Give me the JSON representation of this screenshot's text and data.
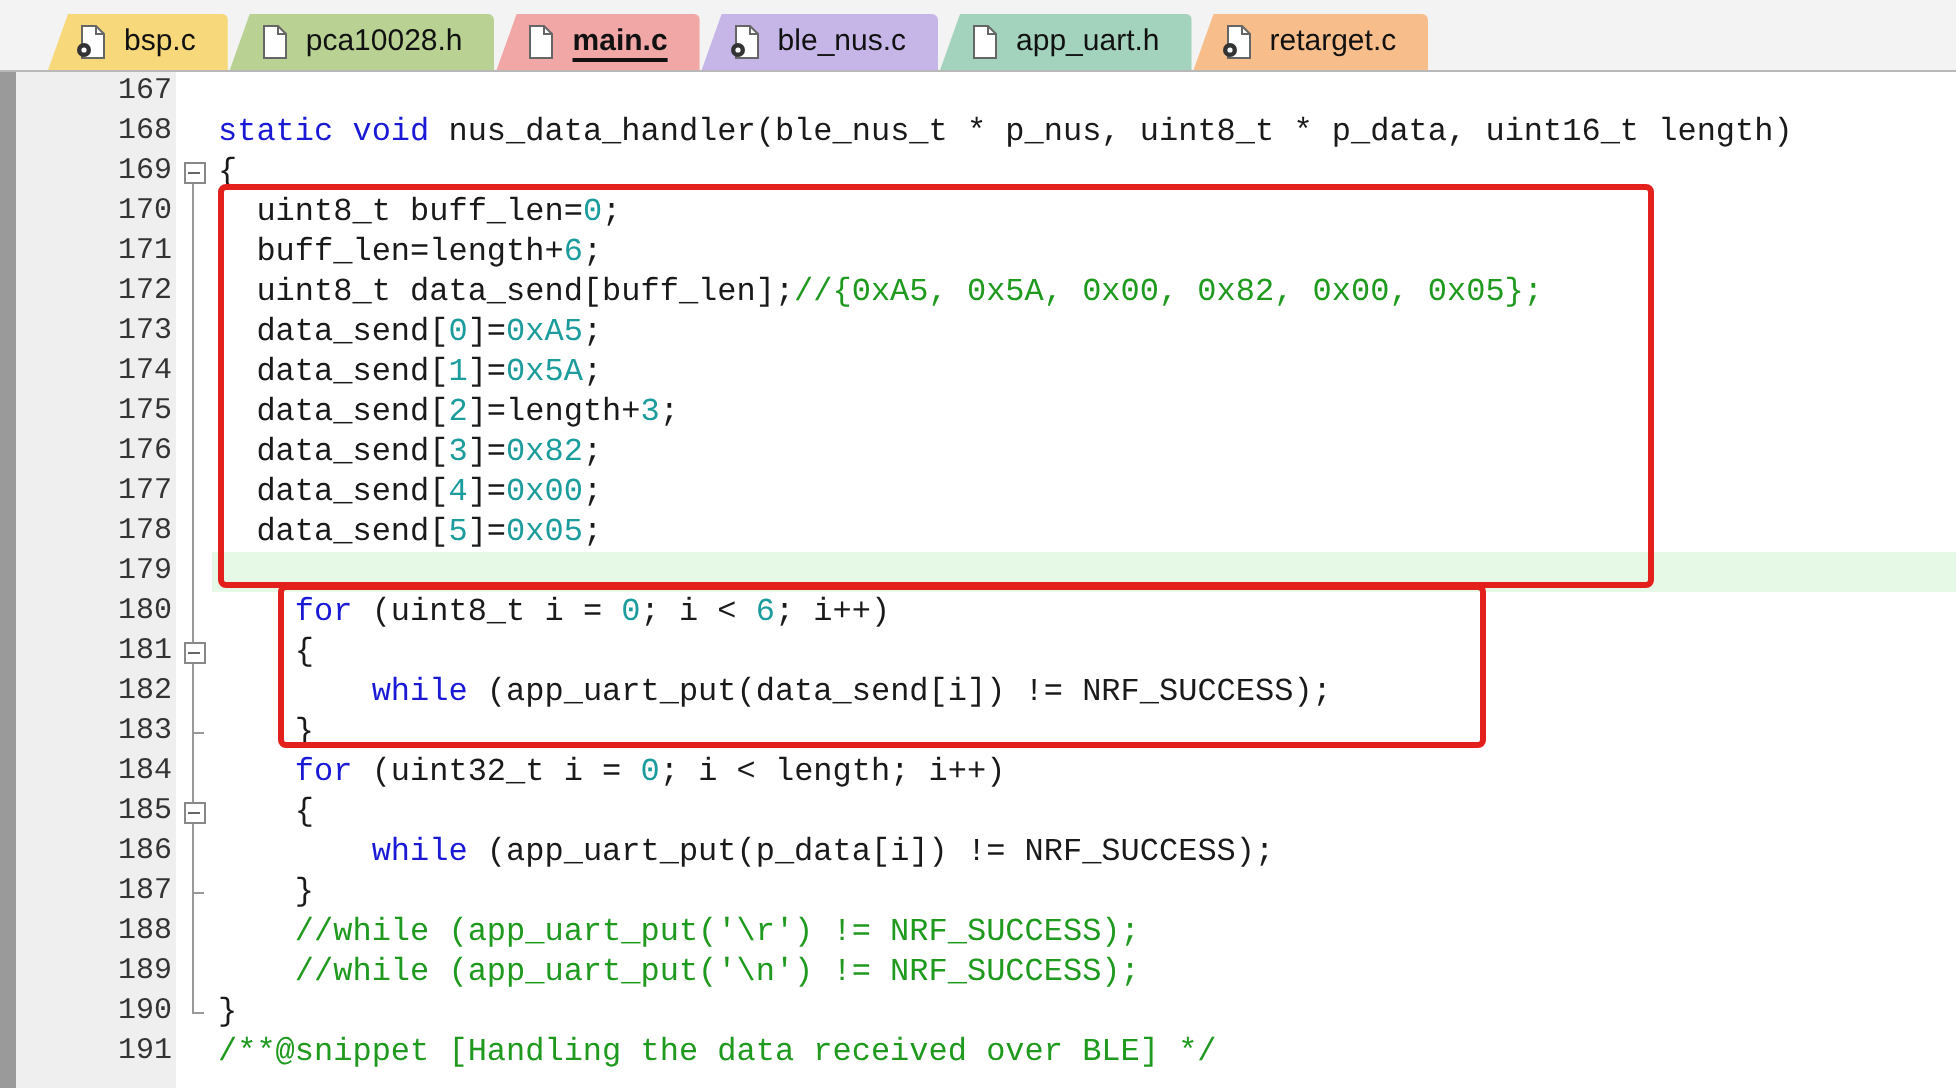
{
  "tabs": [
    {
      "label": "bsp.c",
      "kind": "source",
      "color": "#f7d87a",
      "selected": false
    },
    {
      "label": "pca10028.h",
      "kind": "header",
      "color": "#b9d193",
      "selected": false
    },
    {
      "label": "main.c",
      "kind": "header",
      "color": "#f2a7a7",
      "selected": true
    },
    {
      "label": "ble_nus.c",
      "kind": "source",
      "color": "#c6b6e8",
      "selected": false
    },
    {
      "label": "app_uart.h",
      "kind": "header",
      "color": "#a3d3bc",
      "selected": false
    },
    {
      "label": "retarget.c",
      "kind": "source",
      "color": "#f7be8c",
      "selected": false
    }
  ],
  "lines": [
    {
      "number": "167",
      "fold_start": false,
      "fold_end": false,
      "current": false,
      "box_start": false,
      "box_end": false
    },
    {
      "number": "168",
      "fold_start": false,
      "fold_end": false,
      "current": false,
      "box_start": false,
      "box_end": false,
      "tokens": [
        {
          "kind": "keyword",
          "text": "static"
        },
        {
          "kind": "keyword",
          "text": " void"
        },
        {
          "kind": "plain",
          "text": " nus_data_handler(ble_nus_t * p_nus, uint8_t * p_data, uint16_t length)"
        }
      ]
    },
    {
      "number": "169",
      "fold_start": true,
      "fold_end": false,
      "current": false,
      "box_start": false,
      "box_end": false,
      "tokens": [
        {
          "kind": "plain",
          "text": "{"
        }
      ]
    },
    {
      "number": "170",
      "fold_start": false,
      "fold_end": false,
      "current": false,
      "box_start": true,
      "box_end": false,
      "tokens": [
        {
          "kind": "plain",
          "text": "  uint8_t buff_len="
        },
        {
          "kind": "number",
          "text": "0"
        },
        {
          "kind": "plain",
          "text": ";"
        }
      ]
    },
    {
      "number": "171",
      "fold_start": false,
      "fold_end": false,
      "current": false,
      "box_start": false,
      "box_end": false,
      "tokens": [
        {
          "kind": "plain",
          "text": "  buff_len=length+"
        },
        {
          "kind": "number",
          "text": "6"
        },
        {
          "kind": "plain",
          "text": ";"
        }
      ]
    },
    {
      "number": "172",
      "fold_start": false,
      "fold_end": false,
      "current": false,
      "box_start": false,
      "box_end": false,
      "tokens": [
        {
          "kind": "plain",
          "text": "  uint8_t data_send[buff_len];"
        },
        {
          "kind": "comment",
          "text": "//{0xA5, 0x5A, 0x00, 0x82, 0x00, 0x05};"
        }
      ]
    },
    {
      "number": "173",
      "fold_start": false,
      "fold_end": false,
      "current": false,
      "box_start": false,
      "box_end": false,
      "tokens": [
        {
          "kind": "plain",
          "text": "  data_send["
        },
        {
          "kind": "number",
          "text": "0"
        },
        {
          "kind": "plain",
          "text": "]="
        },
        {
          "kind": "number",
          "text": "0xA5"
        },
        {
          "kind": "plain",
          "text": ";"
        }
      ]
    },
    {
      "number": "174",
      "fold_start": false,
      "fold_end": false,
      "current": false,
      "box_start": false,
      "box_end": false,
      "tokens": [
        {
          "kind": "plain",
          "text": "  data_send["
        },
        {
          "kind": "number",
          "text": "1"
        },
        {
          "kind": "plain",
          "text": "]="
        },
        {
          "kind": "number",
          "text": "0x5A"
        },
        {
          "kind": "plain",
          "text": ";"
        }
      ]
    },
    {
      "number": "175",
      "fold_start": false,
      "fold_end": false,
      "current": false,
      "box_start": false,
      "box_end": false,
      "tokens": [
        {
          "kind": "plain",
          "text": "  data_send["
        },
        {
          "kind": "number",
          "text": "2"
        },
        {
          "kind": "plain",
          "text": "]=length+"
        },
        {
          "kind": "number",
          "text": "3"
        },
        {
          "kind": "plain",
          "text": ";"
        }
      ]
    },
    {
      "number": "176",
      "fold_start": false,
      "fold_end": false,
      "current": false,
      "box_start": false,
      "box_end": false,
      "tokens": [
        {
          "kind": "plain",
          "text": "  data_send["
        },
        {
          "kind": "number",
          "text": "3"
        },
        {
          "kind": "plain",
          "text": "]="
        },
        {
          "kind": "number",
          "text": "0x82"
        },
        {
          "kind": "plain",
          "text": ";"
        }
      ]
    },
    {
      "number": "177",
      "fold_start": false,
      "fold_end": false,
      "current": false,
      "box_start": false,
      "box_end": false,
      "tokens": [
        {
          "kind": "plain",
          "text": "  data_send["
        },
        {
          "kind": "number",
          "text": "4"
        },
        {
          "kind": "plain",
          "text": "]="
        },
        {
          "kind": "number",
          "text": "0x00"
        },
        {
          "kind": "plain",
          "text": ";"
        }
      ]
    },
    {
      "number": "178",
      "fold_start": false,
      "fold_end": false,
      "current": false,
      "box_start": false,
      "box_end": false,
      "tokens": [
        {
          "kind": "plain",
          "text": "  data_send["
        },
        {
          "kind": "number",
          "text": "5"
        },
        {
          "kind": "plain",
          "text": "]="
        },
        {
          "kind": "number",
          "text": "0x05"
        },
        {
          "kind": "plain",
          "text": ";"
        }
      ]
    },
    {
      "number": "179",
      "fold_start": false,
      "fold_end": false,
      "current": true,
      "box_start": false,
      "box_end": true
    },
    {
      "number": "180",
      "fold_start": false,
      "fold_end": false,
      "current": false,
      "box_start": true,
      "box_end": false,
      "tokens": [
        {
          "kind": "keyword",
          "text": "    for"
        },
        {
          "kind": "plain",
          "text": " (uint8_t i = "
        },
        {
          "kind": "number",
          "text": "0"
        },
        {
          "kind": "plain",
          "text": "; i < "
        },
        {
          "kind": "number",
          "text": "6"
        },
        {
          "kind": "plain",
          "text": "; i++)"
        }
      ]
    },
    {
      "number": "181",
      "fold_start": true,
      "fold_end": false,
      "current": false,
      "box_start": false,
      "box_end": false,
      "tokens": [
        {
          "kind": "plain",
          "text": "    {"
        }
      ]
    },
    {
      "number": "182",
      "fold_start": false,
      "fold_end": false,
      "current": false,
      "box_start": false,
      "box_end": false,
      "tokens": [
        {
          "kind": "keyword",
          "text": "        while"
        },
        {
          "kind": "plain",
          "text": " (app_uart_put(data_send[i]) != NRF_SUCCESS);"
        }
      ]
    },
    {
      "number": "183",
      "fold_start": false,
      "fold_end": true,
      "current": false,
      "box_start": false,
      "box_end": true,
      "tokens": [
        {
          "kind": "plain",
          "text": "    }"
        }
      ]
    },
    {
      "number": "184",
      "fold_start": false,
      "fold_end": false,
      "current": false,
      "box_start": false,
      "box_end": false,
      "tokens": [
        {
          "kind": "keyword",
          "text": "    for"
        },
        {
          "kind": "plain",
          "text": " (uint32_t i = "
        },
        {
          "kind": "number",
          "text": "0"
        },
        {
          "kind": "plain",
          "text": "; i < length; i++)"
        }
      ]
    },
    {
      "number": "185",
      "fold_start": true,
      "fold_end": false,
      "current": false,
      "box_start": false,
      "box_end": false,
      "tokens": [
        {
          "kind": "plain",
          "text": "    {"
        }
      ]
    },
    {
      "number": "186",
      "fold_start": false,
      "fold_end": false,
      "current": false,
      "box_start": false,
      "box_end": false,
      "tokens": [
        {
          "kind": "keyword",
          "text": "        while"
        },
        {
          "kind": "plain",
          "text": " (app_uart_put(p_data[i]) != NRF_SUCCESS);"
        }
      ]
    },
    {
      "number": "187",
      "fold_start": false,
      "fold_end": true,
      "current": false,
      "box_start": false,
      "box_end": false,
      "tokens": [
        {
          "kind": "plain",
          "text": "    }"
        }
      ]
    },
    {
      "number": "188",
      "fold_start": false,
      "fold_end": false,
      "current": false,
      "box_start": false,
      "box_end": false,
      "tokens": [
        {
          "kind": "comment",
          "text": "    //while (app_uart_put('\\r') != NRF_SUCCESS);"
        }
      ]
    },
    {
      "number": "189",
      "fold_start": false,
      "fold_end": false,
      "current": false,
      "box_start": false,
      "box_end": false,
      "tokens": [
        {
          "kind": "comment",
          "text": "    //while (app_uart_put('\\n') != NRF_SUCCESS);"
        }
      ]
    },
    {
      "number": "190",
      "fold_start": false,
      "fold_end": true,
      "current": false,
      "box_start": false,
      "box_end": false,
      "tokens": [
        {
          "kind": "plain",
          "text": "}"
        }
      ]
    },
    {
      "number": "191",
      "fold_start": false,
      "fold_end": false,
      "current": false,
      "box_start": false,
      "box_end": false,
      "tokens": [
        {
          "kind": "comment",
          "text": "/**@snippet [Handling the data received over BLE] */"
        }
      ]
    }
  ]
}
